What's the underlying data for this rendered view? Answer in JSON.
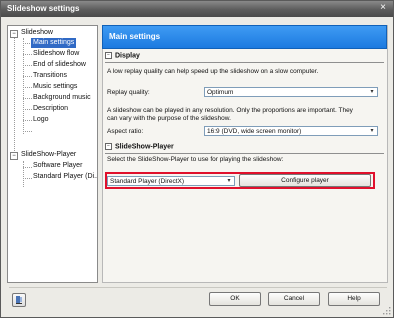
{
  "window": {
    "title": "Slideshow settings",
    "close_glyph": "×"
  },
  "tree": {
    "items": [
      {
        "label": "Slideshow"
      },
      {
        "label": "Main settings"
      },
      {
        "label": "Slideshow flow"
      },
      {
        "label": "End of slideshow"
      },
      {
        "label": "Transitions"
      },
      {
        "label": "Music settings"
      },
      {
        "label": "Background music"
      },
      {
        "label": "Description"
      },
      {
        "label": "Logo"
      },
      {
        "label": "SlideShow-Player"
      },
      {
        "label": "Software Player"
      },
      {
        "label": "Standard Player (Di..."
      }
    ],
    "expander_glyph": "−",
    "selected_index": 1
  },
  "main": {
    "banner": "Main settings",
    "display": {
      "header": "Display",
      "desc1": "A low replay quality can help speed up the slideshow on a slow computer.",
      "replay_label": "Replay quality:",
      "replay_value": "Optimum",
      "desc2": "A slideshow can be played in any resolution. Only the proportions are important. They",
      "desc3": "can vary with the purpose of the slideshow.",
      "aspect_label": "Aspect ratio:",
      "aspect_value": "16:9 (DVD, wide screen monitor)"
    },
    "player": {
      "header": "SlideShow-Player",
      "desc": "Select the SlideShow-Player to use for playing the slideshow:",
      "player_value": "Standard Player (DirectX)",
      "configure_label": "Configure player"
    }
  },
  "footer": {
    "ok_label": "OK",
    "cancel_label": "Cancel",
    "help_label": "Help"
  },
  "icons": {
    "dropdown": "▾",
    "section_toggle": "−"
  },
  "colors": {
    "banner": "#1c7ae0",
    "selection": "#316ac5",
    "highlight": "#e0102c"
  }
}
